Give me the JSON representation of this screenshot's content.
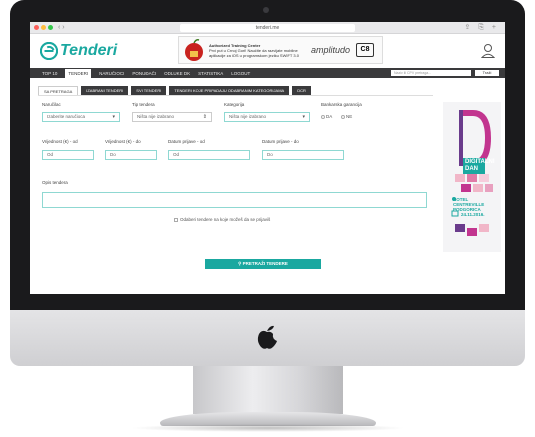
{
  "browser": {
    "nav_arrows": "‹ ›",
    "address": "tenderi.me",
    "right_icons": "⇪ ⎘ +"
  },
  "site": {
    "logo_text": "Tenderi",
    "banner": {
      "heading": "Authorized Training Center",
      "text": "Prvi put u Crnoj Gori! Naučite da razvijate mobilne aplikacije za iOS u programskom jeziku SWIFT 3.0",
      "brand": "amplitudo",
      "badge": "C8"
    }
  },
  "navbar": {
    "items": [
      "Top 10",
      "Tenderi",
      "Naručioci",
      "Ponuđači",
      "Odluke DK",
      "Statistika",
      "Logout"
    ],
    "active_index": 1,
    "search_placeholder": "Naziv ili CPV pretraga...",
    "search_button": "Traži"
  },
  "subtabs": {
    "items": [
      "Sa pretraga",
      "Izabrani tenderi",
      "Svi tenderi",
      "Tenderi koje pripadaju odabranim kategorijama",
      "DCR"
    ],
    "active_index": 0
  },
  "form": {
    "narucilac_label": "Naručilac",
    "narucilac_value": "Izaberite naručioca",
    "tip_label": "Tip tendera",
    "tip_value": "Ništa nije izabrano",
    "kategorija_label": "Kategorija",
    "kategorija_value": "Ništa nije izabrano",
    "bankarska_label": "Bankarska garancija",
    "bankarska_da": "DA",
    "bankarska_ne": "NE",
    "vrijednost_od_label": "Vrijednost (€) - od",
    "vrijednost_od_placeholder": "Od",
    "vrijednost_do_label": "Vrijednost (€) - do",
    "vrijednost_do_placeholder": "Do",
    "datum_od_label": "Datum prijave - od",
    "datum_od_placeholder": "Od",
    "datum_do_label": "Datum prijave - do",
    "datum_do_placeholder": "Do",
    "opis_label": "Opis tendera",
    "checkbox_label": "Odaberi tendere na koje možeš da se prijaviš",
    "search_button": "Pretraži tendere"
  },
  "ad": {
    "title": "DIGITALNI DAN",
    "location": "HOTEL CENTREVILLE PODGORICA",
    "date": "24.11.2016."
  },
  "colors": {
    "accent": "#1aa8a0",
    "nav_dark": "#3a3a3c",
    "ad_magenta": "#c2358f",
    "ad_purple": "#6a3b8c"
  }
}
